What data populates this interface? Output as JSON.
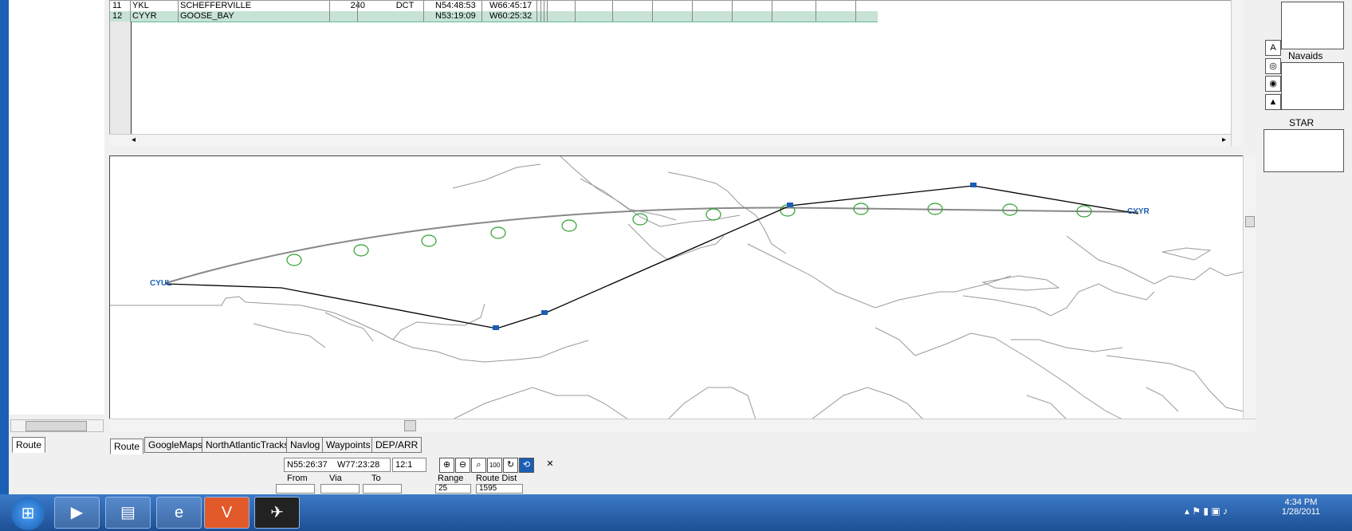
{
  "table": {
    "rows": [
      {
        "num": "11",
        "ident": "YKL",
        "name": "SCHEFFERVILLE",
        "freq": "240",
        "via": "DCT",
        "lat": "N54:48:53",
        "lon": "W66:45:17",
        "selected": false
      },
      {
        "num": "12",
        "ident": "CYYR",
        "name": "GOOSE_BAY",
        "freq": "",
        "via": "",
        "lat": "N53:19:09",
        "lon": "W60:25:32",
        "selected": true
      }
    ]
  },
  "right_panel": {
    "navaids_label": "Navaids",
    "star_label": "STAR",
    "icon_a": "A",
    "icon_up": "▲"
  },
  "map": {
    "origin_label": "CYUL",
    "dest_label": "CYYR",
    "tick_a": "◂",
    "tick_b": "▸"
  },
  "tabs": {
    "left": "Route",
    "bottom": [
      "Route",
      "GoogleMaps",
      "NorthAtlanticTracks",
      "Navlog",
      "Waypoints",
      "DEP/ARR"
    ]
  },
  "status": {
    "lat": "N55:26:37",
    "lon": "W77:23:28",
    "zoom": "12:1"
  },
  "route_form": {
    "from_label": "From",
    "via_label": "Via",
    "to_label": "To",
    "range_label": "Range",
    "range_value": "25",
    "dist_label": "Route Dist",
    "dist_value": "1595"
  },
  "taskbar": {
    "time": "4:34 PM",
    "date": "1/28/2011"
  },
  "colors": {
    "accent": "#1a5fb4",
    "selected_row": "#c7e3d6",
    "gc_circle": "#2ea02e"
  }
}
